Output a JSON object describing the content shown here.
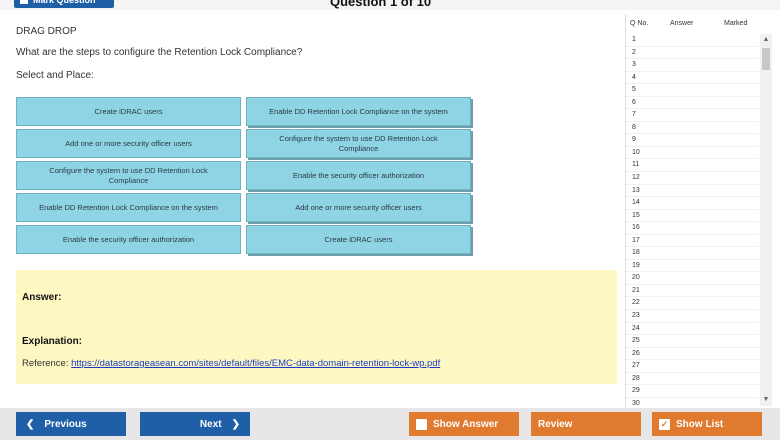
{
  "header": {
    "mark_label": "Mark Question",
    "question_title": "Question 1 of 10"
  },
  "question": {
    "type": "DRAG DROP",
    "text": "What are the steps to configure the Retention Lock Compliance?",
    "instruction": "Select and Place:"
  },
  "drag_drop": {
    "left_boxes": [
      "Create iDRAC users",
      "Add one or more security officer users",
      "Configure the system to use DD Retention Lock Compliance",
      "Enable DD Retention Lock Compliance on the system",
      "Enable the security officer authorization"
    ],
    "right_boxes": [
      "Enable DD Retention Lock Compliance on the system",
      "Configure the system to use DD Retention Lock Compliance",
      "Enable the security officer authorization",
      "Add one or more security officer users",
      "Create iDRAC users"
    ]
  },
  "answer_panel": {
    "answer_label": "Answer:",
    "explanation_label": "Explanation:",
    "reference_prefix": "Reference:",
    "reference_url": "https://datastorageasean.com/sites/default/files/EMC-data-domain-retention-lock-wp.pdf"
  },
  "question_list": {
    "headers": [
      "Q No.",
      "Answer",
      "Marked"
    ],
    "numbers": [
      "1",
      "2",
      "3",
      "4",
      "5",
      "6",
      "7",
      "8",
      "9",
      "10",
      "11",
      "12",
      "13",
      "14",
      "15",
      "16",
      "17",
      "18",
      "19",
      "20",
      "21",
      "22",
      "23",
      "24",
      "25",
      "26",
      "27",
      "28",
      "29",
      "30"
    ]
  },
  "footer": {
    "previous_label": "Previous",
    "next_label": "Next",
    "show_answer_label": "Show Answer",
    "review_label": "Review",
    "show_list_label": "Show List"
  },
  "colors": {
    "nav_blue": "#1f5fa8",
    "action_orange": "#e07a2e",
    "drag_box": "#8fd4e4",
    "answer_bg": "#fdf8c2"
  }
}
